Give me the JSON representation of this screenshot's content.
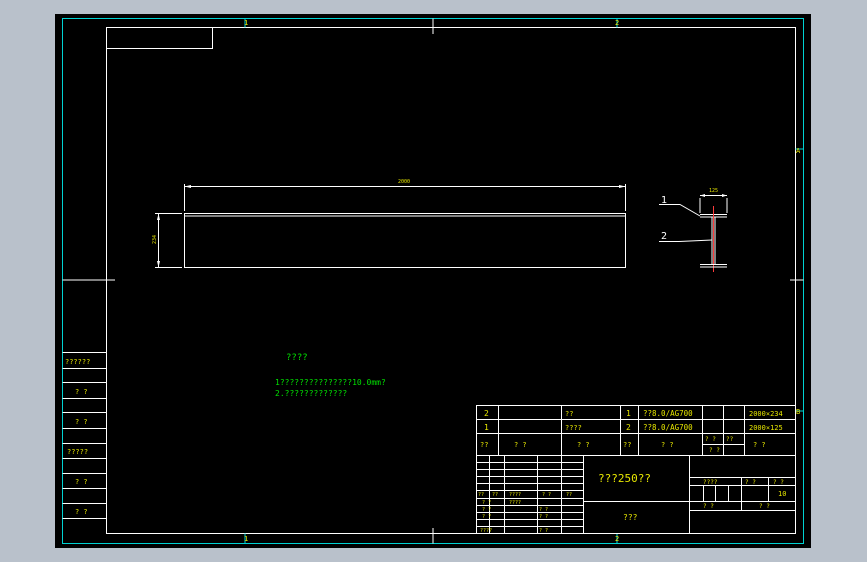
{
  "frame": {
    "zone_top_left": "1",
    "zone_top_right": "2",
    "zone_bottom_left": "1",
    "zone_bottom_right": "2",
    "zone_right_upper": "A",
    "zone_right_lower": "B"
  },
  "drawing": {
    "dim_length": "2000",
    "dim_height": "234",
    "dim_width": "125",
    "leader_1": "1",
    "leader_2": "2"
  },
  "notes": {
    "title": "????",
    "line_1": "1???????????????10.0mm?",
    "line_2": "2.?????????????"
  },
  "side_table": [
    "??????",
    "? ?",
    "? ?",
    "?????",
    "? ?",
    "? ?"
  ],
  "bom": [
    {
      "seq": "2",
      "name": "??",
      "qty": "1",
      "material": "??8.0/AG700",
      "size": "2000×234"
    },
    {
      "seq": "1",
      "name": "????",
      "qty": "2",
      "material": "??8.0/AG700",
      "size": "2000×125"
    }
  ],
  "bom_header": {
    "seq": "??",
    "code": "? ?",
    "name": "? ?",
    "qty": "??",
    "material": "? ?",
    "single": "? ?",
    "total": "??",
    "note": "? ?",
    "single2": "? ?"
  },
  "title_block": {
    "drawing_name": "???250??",
    "company": "???",
    "stage_label": "????",
    "weight_label": "? ?",
    "scale_label": "? ?",
    "scale_value": "10",
    "sheet_label": "? ?",
    "sheets_label": "? ?",
    "sign_rows": [
      {
        "c1": "??",
        "c2": "??",
        "c3": "????",
        "c4": "? ?",
        "c5": "??"
      },
      {
        "c1": "? ?",
        "c2": "????",
        "c3": "",
        "c4": "",
        "c5": ""
      },
      {
        "c1": "? ?",
        "c2": "? ?",
        "c3": "",
        "c4": "",
        "c5": ""
      },
      {
        "c1": "? ?",
        "c2": "? ?",
        "c3": "",
        "c4": "",
        "c5": ""
      },
      {
        "c1": "????",
        "c2": "? ?",
        "c3": "",
        "c4": "",
        "c5": ""
      }
    ]
  }
}
